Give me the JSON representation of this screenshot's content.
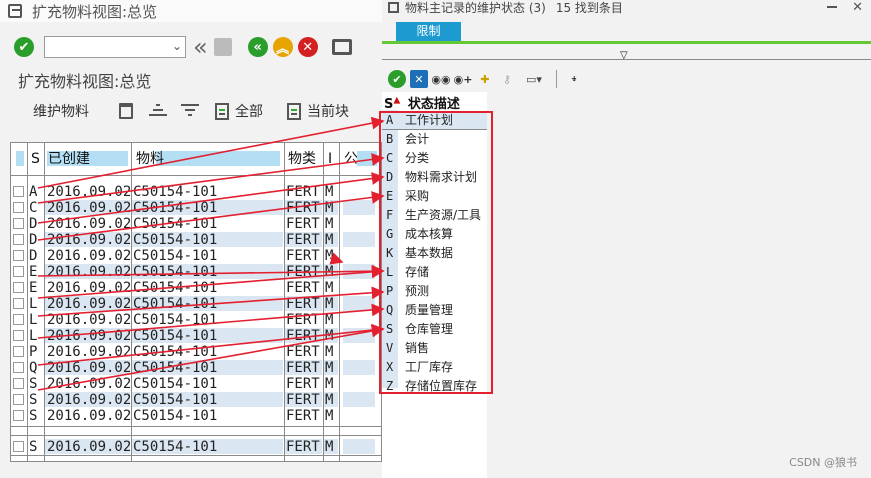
{
  "main_window": {
    "title": "扩充物料视图:总览",
    "page_title": "扩充物料视图:总览",
    "toolbar2": {
      "maintain_label": "维护物料",
      "all_label": "全部",
      "current_block_label": "当前块"
    },
    "table": {
      "headers": [
        "S",
        "已创建",
        "物料",
        "物类",
        "I",
        "公"
      ],
      "rows": [
        {
          "s": "A",
          "date": "2016.09.02",
          "material": "C50154-101",
          "type": "FERT",
          "i": "M"
        },
        {
          "s": "C",
          "date": "2016.09.02",
          "material": "C50154-101",
          "type": "FERT",
          "i": "M"
        },
        {
          "s": "D",
          "date": "2016.09.02",
          "material": "C50154-101",
          "type": "FERT",
          "i": "M"
        },
        {
          "s": "D",
          "date": "2016.09.02",
          "material": "C50154-101",
          "type": "FERT",
          "i": "M"
        },
        {
          "s": "D",
          "date": "2016.09.02",
          "material": "C50154-101",
          "type": "FERT",
          "i": "M"
        },
        {
          "s": "E",
          "date": "2016.09.02",
          "material": "C50154-101",
          "type": "FERT",
          "i": "M"
        },
        {
          "s": "E",
          "date": "2016.09.02",
          "material": "C50154-101",
          "type": "FERT",
          "i": "M"
        },
        {
          "s": "L",
          "date": "2016.09.02",
          "material": "C50154-101",
          "type": "FERT",
          "i": "M"
        },
        {
          "s": "L",
          "date": "2016.09.02",
          "material": "C50154-101",
          "type": "FERT",
          "i": "M"
        },
        {
          "s": "L",
          "date": "2016.09.02",
          "material": "C50154-101",
          "type": "FERT",
          "i": "M"
        },
        {
          "s": "P",
          "date": "2016.09.02",
          "material": "C50154-101",
          "type": "FERT",
          "i": "M"
        },
        {
          "s": "Q",
          "date": "2016.09.02",
          "material": "C50154-101",
          "type": "FERT",
          "i": "M"
        },
        {
          "s": "S",
          "date": "2016.09.02",
          "material": "C50154-101",
          "type": "FERT",
          "i": "M"
        },
        {
          "s": "S",
          "date": "2016.09.02",
          "material": "C50154-101",
          "type": "FERT",
          "i": "M"
        },
        {
          "s": "S",
          "date": "2016.09.02",
          "material": "C50154-101",
          "type": "FERT",
          "i": "M"
        }
      ],
      "total_row": {
        "s": "S",
        "date": "2016.09.02",
        "material": "C50154-101",
        "type": "FERT",
        "i": "M"
      }
    }
  },
  "popup": {
    "title": "物料主记录的维护状态 (3)",
    "entries_found": "15 找到条目",
    "tab_label": "限制",
    "list_header": "状态描述",
    "list_header_key": "S",
    "items": [
      {
        "key": "A",
        "label": "工作计划"
      },
      {
        "key": "B",
        "label": "会计"
      },
      {
        "key": "C",
        "label": "分类"
      },
      {
        "key": "D",
        "label": "物料需求计划"
      },
      {
        "key": "E",
        "label": "采购"
      },
      {
        "key": "F",
        "label": "生产资源/工具"
      },
      {
        "key": "G",
        "label": "成本核算"
      },
      {
        "key": "K",
        "label": "基本数据"
      },
      {
        "key": "L",
        "label": "存储"
      },
      {
        "key": "P",
        "label": "预测"
      },
      {
        "key": "Q",
        "label": "质量管理"
      },
      {
        "key": "S",
        "label": "仓库管理"
      },
      {
        "key": "V",
        "label": "销售"
      },
      {
        "key": "X",
        "label": "工厂库存"
      },
      {
        "key": "Z",
        "label": "存储位置库存"
      }
    ]
  },
  "colors": {
    "tab_blue": "#1d9bd1",
    "highlight_green": "#62c935",
    "annotation_red": "#e3202f",
    "header_blue": "#b4def3"
  },
  "watermark": "CSDN @狼书"
}
